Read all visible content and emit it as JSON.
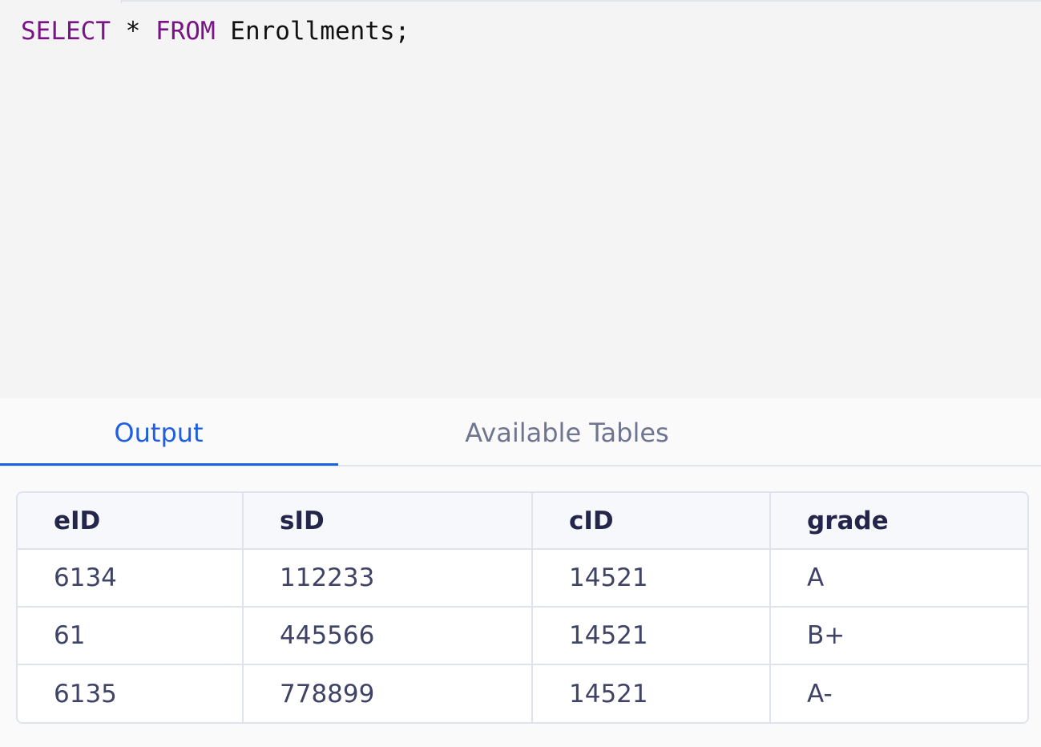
{
  "editor": {
    "query_keyword_select": "SELECT",
    "query_star": " * ",
    "query_keyword_from": "FROM",
    "query_table": " Enrollments;"
  },
  "tabs": {
    "output_label": "Output",
    "available_tables_label": "Available Tables",
    "active": "Output"
  },
  "colors": {
    "keyword": "#7a1486",
    "active_tab": "#1d5fe0",
    "inactive_tab": "#6f7590"
  },
  "result": {
    "columns": [
      "eID",
      "sID",
      "cID",
      "grade"
    ],
    "rows": [
      [
        "6134",
        "112233",
        "14521",
        "A"
      ],
      [
        "61",
        "445566",
        "14521",
        "B+"
      ],
      [
        "6135",
        "778899",
        "14521",
        "A-"
      ]
    ]
  }
}
